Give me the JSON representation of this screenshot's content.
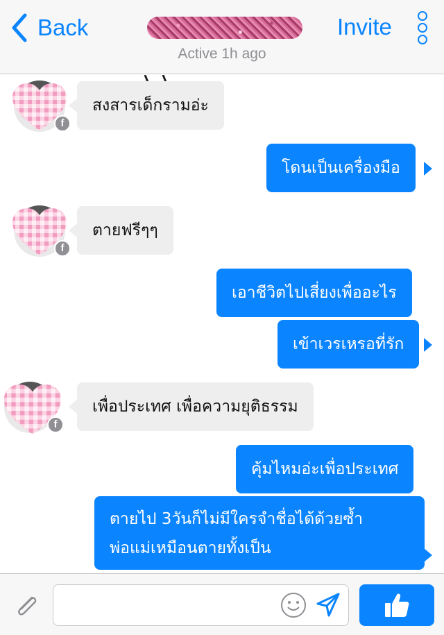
{
  "header": {
    "back_label": "Back",
    "contact_name": "",
    "status": "Active 1h ago",
    "invite_label": "Invite"
  },
  "messages": [
    {
      "direction": "incoming",
      "text": "สงสารเด็กรามอ่ะ"
    },
    {
      "direction": "outgoing",
      "text": "โดนเป็นเครื่องมือ"
    },
    {
      "direction": "incoming",
      "text": "ตายฟรีๆๆ"
    },
    {
      "direction": "outgoing",
      "text": "เอาชีวิตไปเสี่ยงเพื่ออะไร"
    },
    {
      "direction": "outgoing",
      "text": "เข้าเวรเหรอที่รัก"
    },
    {
      "direction": "incoming",
      "text": "เพื่อประเทศ เพื่อความยุติธรรม"
    },
    {
      "direction": "outgoing",
      "text": "คุ้มไหมอ่ะเพื่อประเทศ"
    },
    {
      "direction": "outgoing",
      "text_line1": "ตายไป 3วันก็ไม่มีใครจำชื่อได้ด้วยซ้ำ",
      "text_line2": "พ่อแม่เหมือนตายทั้งเป็น"
    }
  ],
  "composer": {
    "input_value": "",
    "input_placeholder": ""
  },
  "icons": {
    "back": "chevron-left-icon",
    "more": "vertical-dots-icon",
    "attach": "paperclip-icon",
    "emoji": "smiley-icon",
    "send": "send-arrow-icon",
    "like": "thumbs-up-icon",
    "facebook_badge": "facebook-icon"
  },
  "colors": {
    "accent": "#0a84ff",
    "incoming_bubble": "#eeeeef",
    "avatar_heart": "#f6b6cf"
  }
}
